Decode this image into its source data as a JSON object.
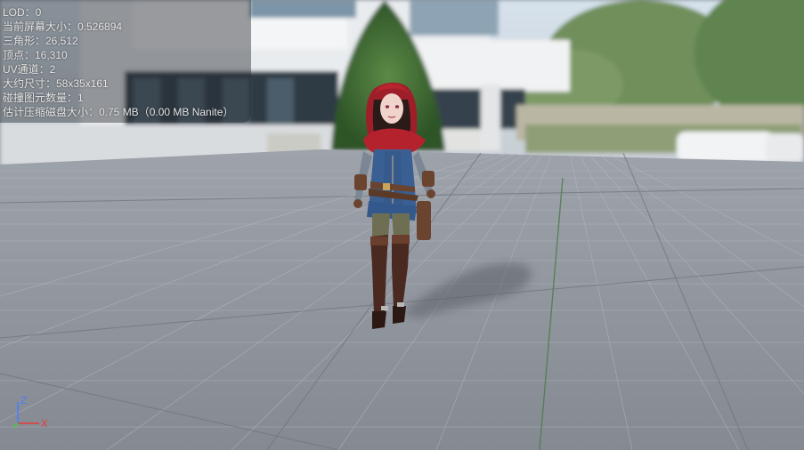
{
  "stats": [
    "LOD：0",
    "当前屏幕大小：0.526894",
    "三角形：26,512",
    "顶点：16,310",
    "UV通道：2",
    "大约尺寸：58x35x161",
    "碰撞图元数量：1",
    "估计压缩磁盘大小：0.75 MB（0.00 MB Nanite）"
  ],
  "axis": {
    "z_label": "Z",
    "x_label": "X"
  },
  "colors": {
    "axis_x": "#e83a3a",
    "axis_y": "#3ad13a",
    "axis_z": "#4a7dff"
  }
}
